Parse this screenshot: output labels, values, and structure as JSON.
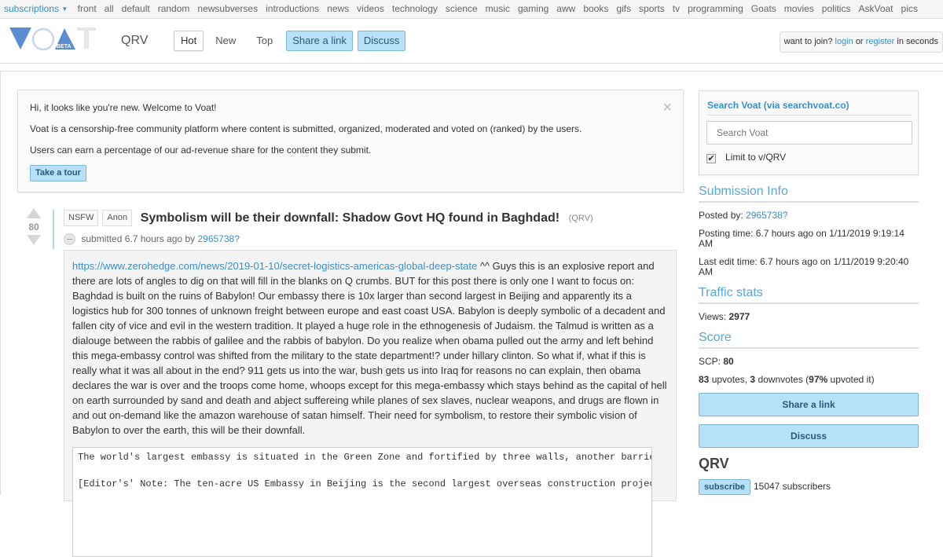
{
  "topbar": {
    "subscriptions": "subscriptions",
    "links": [
      "front",
      "all",
      "default",
      "random",
      "newsubverses",
      "introductions",
      "news",
      "videos",
      "technology",
      "science",
      "music",
      "gaming",
      "aww",
      "books",
      "gifs",
      "sports",
      "tv",
      "programming",
      "Goats",
      "movies",
      "politics",
      "AskVoat",
      "pics"
    ]
  },
  "header": {
    "logo_badge": "BETA",
    "subverse": "QRV",
    "tabs": {
      "hot": "Hot",
      "new": "New",
      "top": "Top",
      "share": "Share a link",
      "discuss": "Discuss"
    },
    "join_prefix": "want to join?",
    "login": "login",
    "or": "or",
    "register": "register",
    "join_suffix": "in seconds"
  },
  "welcome": {
    "line1": "Hi, it looks like you're new. Welcome to Voat!",
    "line2": "Voat is a censorship-free community platform where content is submitted, organized, moderated and voted on (ranked) by the users.",
    "line3": "Users can earn a percentage of our ad-revenue share for the content they submit.",
    "close": "×",
    "tour_button": "Take a tour"
  },
  "post": {
    "score": "80",
    "tags": [
      "NSFW",
      "Anon"
    ],
    "title": "Symbolism will be their downfall: Shadow Govt HQ found in Baghdad!",
    "domain": "(QRV)",
    "submitted_prefix": "submitted",
    "submitted_time": "6.7 hours ago",
    "by": "by",
    "author": "2965738?",
    "link_url": "https://www.zerohedge.com/news/2019-01-10/secret-logistics-americas-global-deep-state",
    "body_text": " ^^ Guys this is an explosive report and there are lots of angles to dig on that will fill in the blanks on Q crumbs. BUT for this post there is only one I want to focus on: Baghdad is built on the ruins of Babylon! Our embassy there is 10x larger than second largest in Beijing and apparently its a logistics hub for 300 tonnes of unknown freight between europe and east coast USA. Babylon is deeply symbolic of a decadent and fallen city of vice and evil in the western tradition. It played a huge role in the ethnogenesis of Judaism. the Talmud is written as a dialouge between the rabbis of galilee and the rabbis of babylon. Do you realize when obama pulled out the army and left behind this mega-embassy control was shifted from the military to the state department!? under hillary clinton. So what if, what if this is really what it was all about in the end? 911 gets us into the war, bush gets us into Iraq for reasons no can explain, then obama declares the war is over and the troops come home, whoops except for this mega-embassy which stays behind as the capital of hell on earth surrounded by sand and death and abject suffereing while planes of sex slaves, nuclear weapons, and drugs are flown in and out on-demand like the amazon warehouse of satan himself. Their need for symbolism, to restore their symbolic vision of Babylon to over the earth, this will be their downfall.",
    "quote_line1": "The world's largest embassy is situated in the Green Zone and fortified by three walls, another barrie",
    "quote_line2": "[Editor's' Note: The ten-acre US Embassy in Beijing is the second largest overseas construction projec"
  },
  "sidebar": {
    "search_title": "Search Voat (via searchvoat.co)",
    "search_placeholder": "Search Voat",
    "limit_label": "Limit to v/QRV",
    "submission_info": "Submission Info",
    "posted_by_label": "Posted by:",
    "posted_by": "2965738?",
    "posting_time": "Posting time: 6.7 hours ago on 1/11/2019 9:19:14 AM",
    "last_edit": "Last edit time: 6.7 hours ago on 1/11/2019 9:20:40 AM",
    "traffic_stats": "Traffic stats",
    "views_label": "Views:",
    "views": "2977",
    "score_heading": "Score",
    "scp_label": "SCP:",
    "scp": "80",
    "upvotes": "83",
    "upvotes_label": "upvotes,",
    "downvotes": "3",
    "downvotes_label": "downvotes (",
    "upvoted_pct": "97%",
    "upvoted_label": "upvoted it)",
    "share_button": "Share a link",
    "discuss_button": "Discuss",
    "subverse_name": "QRV",
    "subscribe_button": "subscribe",
    "subscribers": "15047 subscribers"
  },
  "colors": {
    "link": "#3a8fcb",
    "button_bg": "#b7e1f8",
    "button_border": "#7fb6d5",
    "logo_blue": "#5b8ed1",
    "heading_blue": "#5aa5d6"
  }
}
